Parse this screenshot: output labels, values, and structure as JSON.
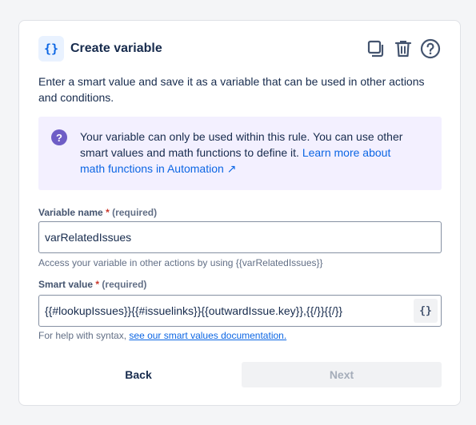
{
  "header": {
    "icon_glyph": "{}",
    "title": "Create variable",
    "actions": [
      {
        "name": "duplicate-icon"
      },
      {
        "name": "trash-icon"
      },
      {
        "name": "help-icon"
      }
    ]
  },
  "description": "Enter a smart value and save it as a variable that can be used in other actions and conditions.",
  "info": {
    "icon_glyph": "?",
    "text": "Your variable can only be used within this rule. You can use other smart values and math functions to define it. ",
    "link": "Learn more about math functions in Automation ↗"
  },
  "variable_name": {
    "label": "Variable name",
    "star": "*",
    "required": "(required)",
    "value": "varRelatedIssues",
    "helper": "Access your variable in other actions by using {{varRelatedIssues}}"
  },
  "smart_value": {
    "label": "Smart value",
    "star": "*",
    "required": "(required)",
    "value": "{{#lookupIssues}}{{#issuelinks}}{{outwardIssue.key}},{{/}}{{/}}",
    "button_glyph": "{}",
    "helper_prefix": "For help with syntax, ",
    "helper_link": "see our smart values documentation."
  },
  "footer": {
    "back": "Back",
    "next": "Next"
  },
  "colors": {
    "accent": "#0c66e4",
    "info_bg": "#f3f0ff",
    "info_icon": "#6e5dc6",
    "required": "#c9372c"
  }
}
